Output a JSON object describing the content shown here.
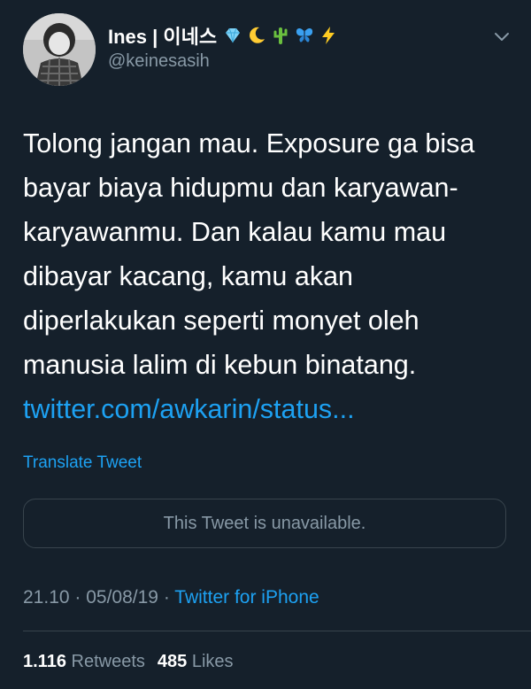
{
  "author": {
    "display_name": "Ines | 이네스",
    "handle": "@keinesasih",
    "emojis": [
      "gem-icon",
      "crescent-moon-icon",
      "cactus-icon",
      "butterfly-icon",
      "lightning-icon"
    ]
  },
  "tweet": {
    "lines": [
      "Tolong jangan mau. Exposure ga bisa",
      "bayar biaya hidupmu dan karyawan-",
      "karyawanmu. Dan kalau kamu mau",
      "dibayar kacang, kamu akan",
      "diperlakukan seperti monyet oleh",
      "manusia lalim di kebun binatang."
    ],
    "link": "twitter.com/awkarin/status...",
    "translate_label": "Translate Tweet",
    "quoted_unavailable": "This Tweet is unavailable."
  },
  "meta": {
    "time": "21.10",
    "separator": " · ",
    "date": "05/08/19",
    "source": "Twitter for iPhone"
  },
  "stats": {
    "retweets_count": "1.116",
    "retweets_label": "Retweets",
    "likes_count": "485",
    "likes_label": "Likes"
  },
  "colors": {
    "background": "#15202b",
    "accent": "#1da1f2",
    "secondary_text": "#8899a6",
    "border": "#38444d"
  }
}
